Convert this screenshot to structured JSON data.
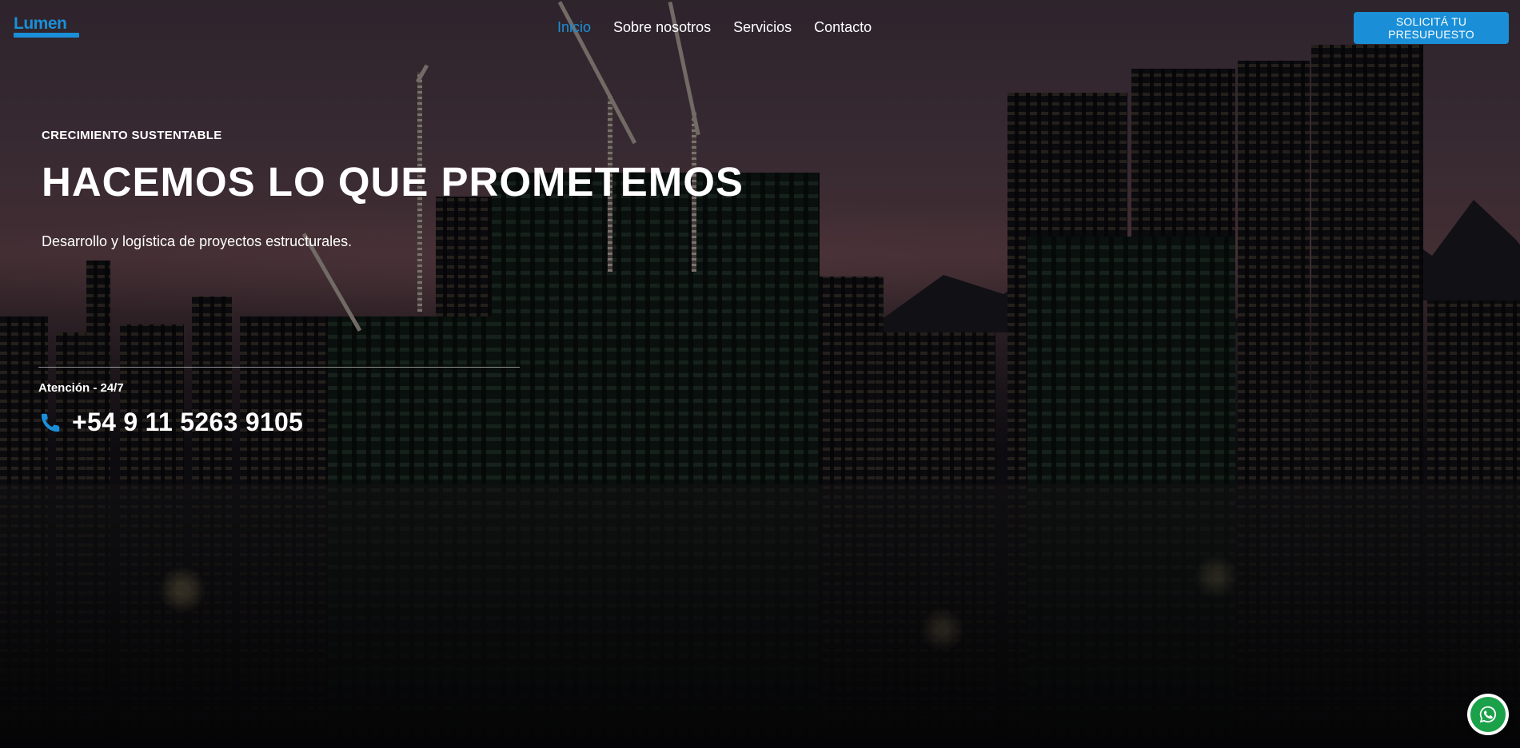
{
  "brand": {
    "logo_text": "Lumen",
    "accent_color": "#1a8fd8"
  },
  "nav": {
    "items": [
      {
        "label": "Inicio",
        "active": true
      },
      {
        "label": "Sobre nosotros",
        "active": false
      },
      {
        "label": "Servicios",
        "active": false
      },
      {
        "label": "Contacto",
        "active": false
      }
    ]
  },
  "cta": {
    "label": "SOLICITÁ TU PRESUPUESTO"
  },
  "hero": {
    "eyebrow": "CRECIMIENTO SUSTENTABLE",
    "title": "HACEMOS LO QUE PROMETEMOS",
    "subtitle": "Desarrollo y logística de proyectos estructurales."
  },
  "contact": {
    "attention_label": "Atención - 24/7",
    "phone_icon": "phone-icon",
    "phone": "+54 9 11 5263 9105"
  },
  "floating": {
    "whatsapp_icon": "whatsapp-icon",
    "whatsapp_color": "#1ba14a"
  }
}
